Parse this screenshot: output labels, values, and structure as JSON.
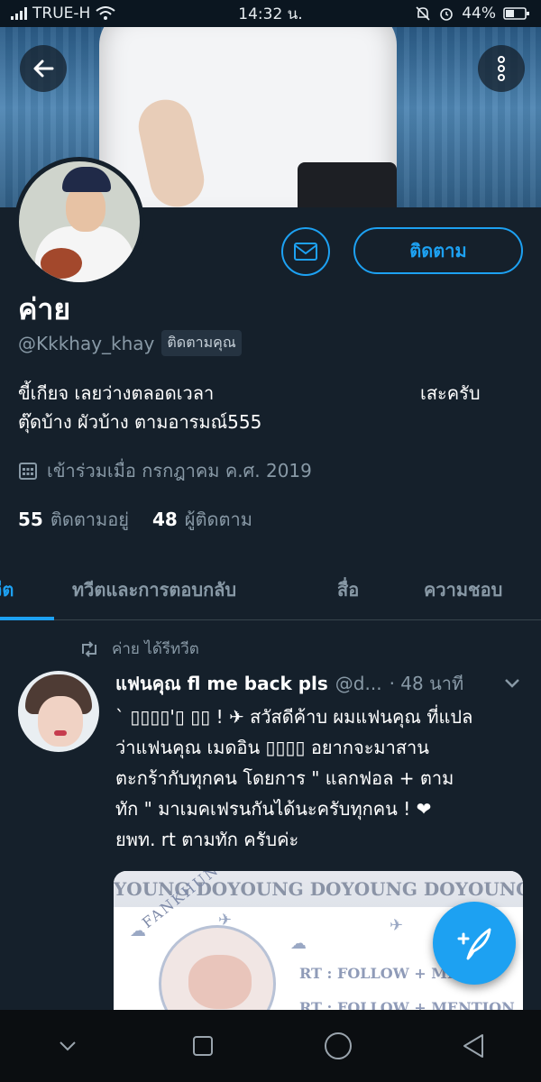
{
  "status_bar": {
    "carrier": "TRUE-H",
    "time": "14:32 น.",
    "battery": "44%"
  },
  "profile": {
    "name": "ค่าย",
    "handle": "@Kkkhay_khay",
    "follows_you": "ติดตามคุณ",
    "follow_button": "ติดตาม",
    "bio_line1_left": "ขี้เกียจ เลยว่างตลอดเวลา",
    "bio_line1_right": "เสะครับ",
    "bio_line2": "ตุ๊ดบ้าง ผัวบ้าง ตามอารมณ์555",
    "joined": "เข้าร่วมเมื่อ กรกฎาคม ค.ศ. 2019",
    "following_count": "55",
    "following_label": "ติดตามอยู่",
    "followers_count": "48",
    "followers_label": "ผู้ติดตาม"
  },
  "tabs": [
    {
      "label": "ทวีต",
      "active": true
    },
    {
      "label": "ทวีตและการตอบกลับ",
      "active": false
    },
    {
      "label": "สื่อ",
      "active": false
    },
    {
      "label": "ความชอบ",
      "active": false
    }
  ],
  "tweet": {
    "retweet_label": "ค่าย ได้รีทวีต",
    "author": "แฟนคุณ fl me back pls",
    "handle": "@d...",
    "time": "· 48 นาที",
    "lines": [
      "` ▯▯▯▯'▯ ▯▯ ! ✈ สวัสดีค้าบ ผมแฟนคุณ ที่แปล",
      "ว่าแฟนคุณ เมดอิน ▯▯▯▯ อยากจะมาสาน",
      "ตะกร้ากับทุกคน โดยการ \" แลกฟอล + ตาม",
      "ทัก \" มาเมคเฟรนกันได้นะครับทุกคน ! ❤",
      "ยพท. rt ตามทัก ครับค่ะ"
    ],
    "media": {
      "band_text": "YOUNG DOYOUNG DOYOUNG DOYOUNG D",
      "arc_text": "FANKHUN",
      "line1": "RT : FOLLOW + ME",
      "line2": "RT : FOLLOW + MENTION"
    }
  },
  "colors": {
    "background": "#15202b",
    "accent": "#1da1f2",
    "muted": "#8899a6",
    "divider": "#38444d"
  },
  "icons": [
    "back-arrow-icon",
    "more-vertical-icon",
    "mail-icon",
    "calendar-icon",
    "retweet-icon",
    "chevron-down-icon",
    "compose-tweet-icon",
    "nav-back-icon",
    "nav-home-icon",
    "nav-recents-icon"
  ]
}
